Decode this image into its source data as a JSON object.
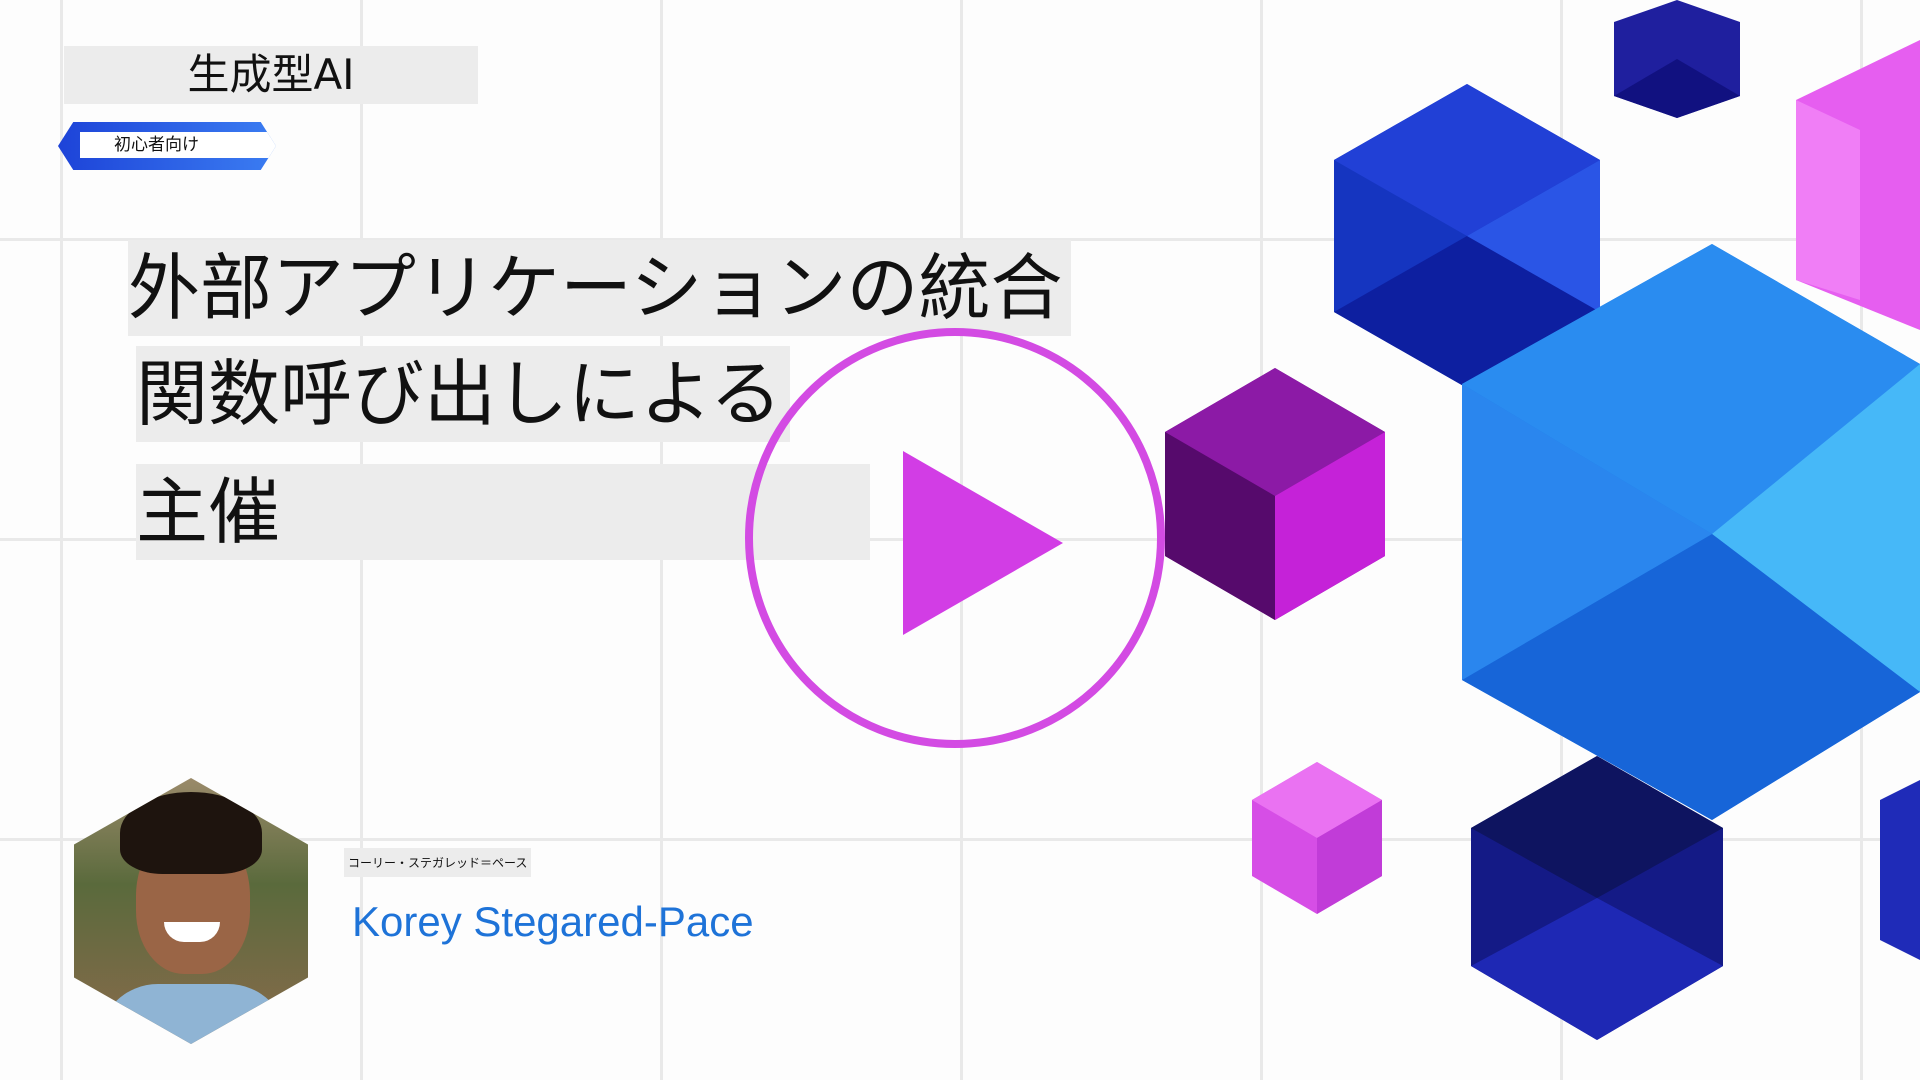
{
  "course": {
    "title": "生成型AI",
    "level": "初心者向け"
  },
  "lesson": {
    "title_lines": [
      "外部アプリケーションの統合",
      "関数呼び出しによる",
      "主催"
    ]
  },
  "host": {
    "caption": "コーリー・ステガレッド＝ペース",
    "name": "Korey Stegared-Pace"
  },
  "icons": {
    "play": "play-icon",
    "avatar": "host-avatar"
  },
  "colors": {
    "accent_magenta": "#d23de5",
    "accent_blue": "#1e73d8",
    "badge_blue": "#1d43d8"
  }
}
